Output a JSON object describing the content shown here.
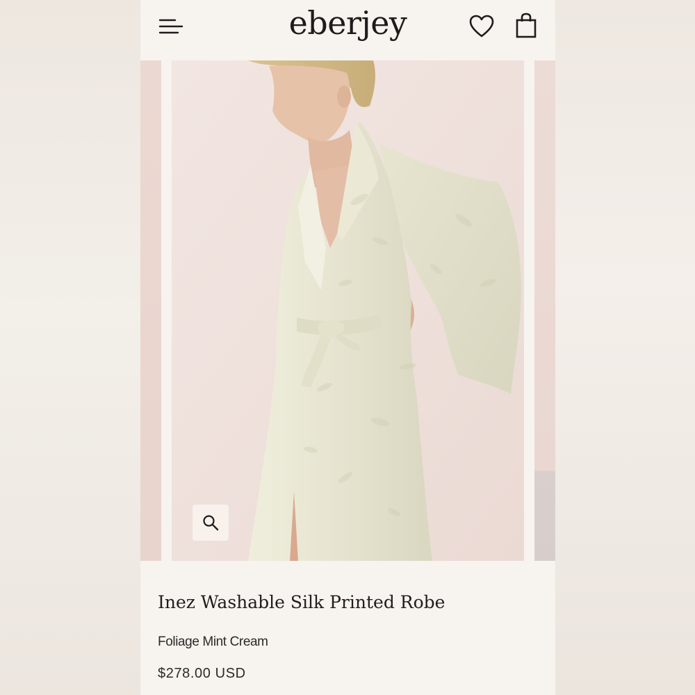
{
  "header": {
    "logo_text": "eberjey",
    "menu_icon": "menu-icon",
    "wishlist_icon": "heart-icon",
    "bag_icon": "shopping-bag-icon"
  },
  "gallery": {
    "zoom_icon": "magnifier-icon",
    "image_alt": "Model wearing the Inez Washable Silk Printed Robe"
  },
  "product": {
    "title": "Inez Washable Silk Printed Robe",
    "variant": "Foliage Mint Cream",
    "price": "$278.00 USD"
  },
  "colors": {
    "page_bg": "#f7f3ee",
    "text": "#1e1e1e",
    "backdrop": "#efe1dc",
    "robe": "#e9e6d2"
  }
}
